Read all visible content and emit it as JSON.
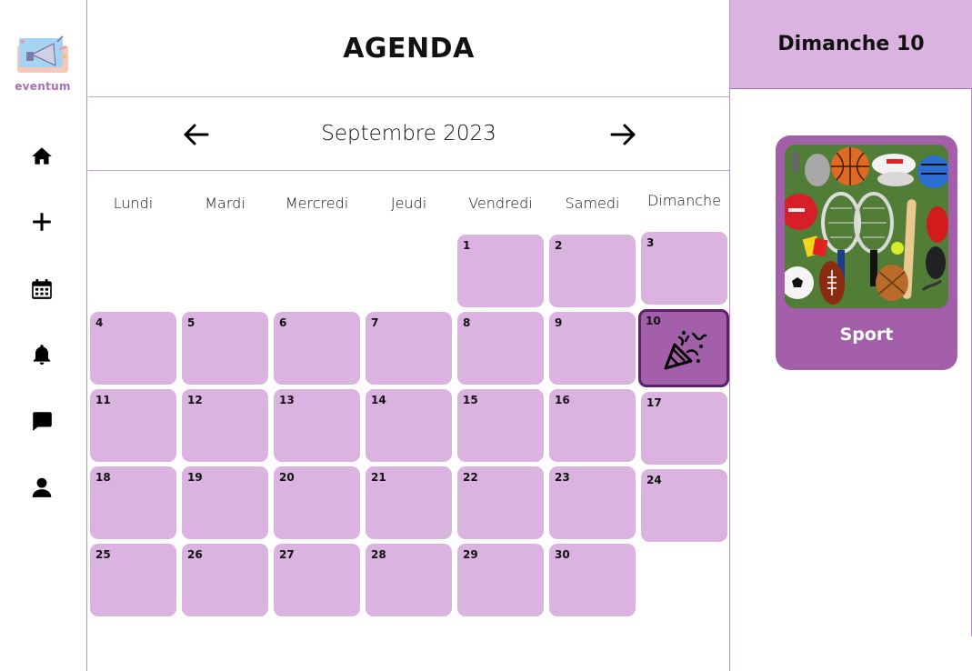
{
  "app": {
    "brand": "eventum",
    "title": "AGENDA"
  },
  "sidebar": {
    "items": [
      {
        "name": "home-icon",
        "label": "Accueil"
      },
      {
        "name": "plus-icon",
        "label": "Ajouter"
      },
      {
        "name": "calendar-icon",
        "label": "Agenda"
      },
      {
        "name": "bell-icon",
        "label": "Notifications"
      },
      {
        "name": "chat-icon",
        "label": "Messages"
      },
      {
        "name": "user-icon",
        "label": "Profil"
      }
    ]
  },
  "calendar": {
    "month_label": "Septembre 2023",
    "weekdays": [
      "Lundi",
      "Mardi",
      "Mercredi",
      "Jeudi",
      "Vendredi",
      "Samedi",
      "Dimanche"
    ],
    "selected_day": "10",
    "days": [
      "1",
      "2",
      "3",
      "4",
      "5",
      "6",
      "7",
      "8",
      "9",
      "10",
      "11",
      "12",
      "13",
      "14",
      "15",
      "16",
      "17",
      "18",
      "19",
      "20",
      "21",
      "22",
      "23",
      "24",
      "25",
      "26",
      "27",
      "28",
      "29",
      "30"
    ]
  },
  "detail": {
    "day_title": "Dimanche 10",
    "event": {
      "category": "Sport",
      "image": "sports-equipment-photo"
    }
  },
  "colors": {
    "cell": "#dbb3e0",
    "selected": "#a35fa9",
    "selected_border": "#5b2266",
    "card": "#a35fa9",
    "divider": "#b58fc6"
  }
}
